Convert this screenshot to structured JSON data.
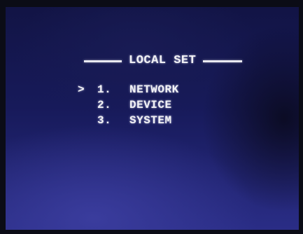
{
  "menu": {
    "title": "LOCAL SET",
    "cursor": ">",
    "items": [
      {
        "number": "1.",
        "label": "NETWORK",
        "selected": true
      },
      {
        "number": "2.",
        "label": "DEVICE",
        "selected": false
      },
      {
        "number": "3.",
        "label": "SYSTEM",
        "selected": false
      }
    ]
  },
  "colors": {
    "text": "#f2f2f6",
    "screen_background": "#171a5a"
  }
}
